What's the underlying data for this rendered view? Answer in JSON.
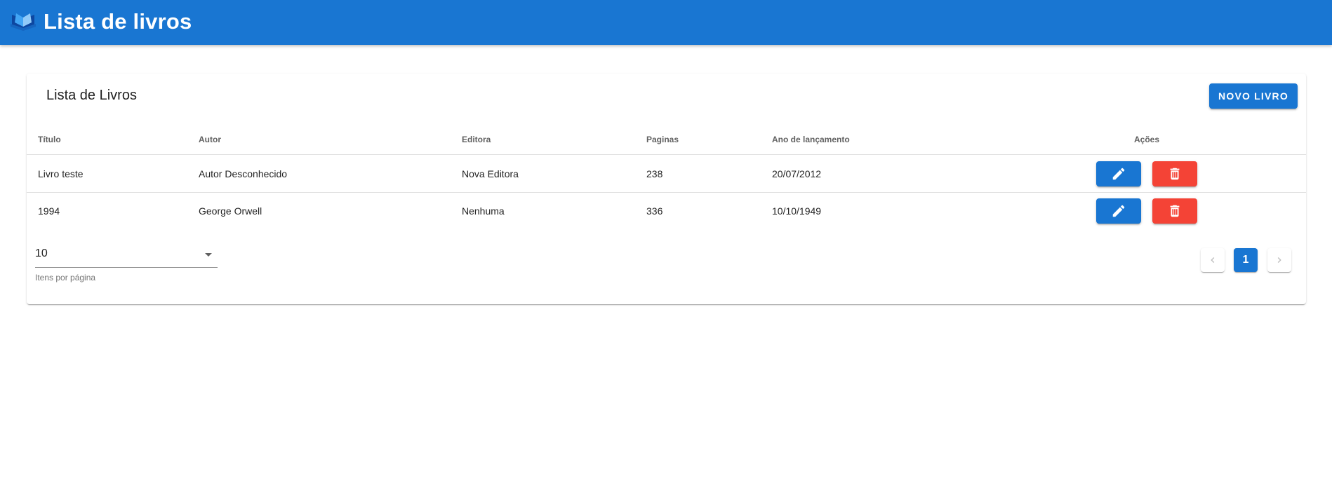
{
  "app_bar": {
    "title": "Lista de livros",
    "logo_icon": "open-book-icon",
    "color": "#1976d2"
  },
  "card": {
    "title": "Lista de Livros",
    "new_button_label": "NOVO LIVRO"
  },
  "table": {
    "headers": {
      "titulo": "Título",
      "autor": "Autor",
      "editora": "Editora",
      "paginas": "Paginas",
      "ano": "Ano de lançamento",
      "acoes": "Ações"
    },
    "rows": [
      {
        "titulo": "Livro teste",
        "autor": "Autor Desconhecido",
        "editora": "Nova Editora",
        "paginas": "238",
        "ano": "20/07/2012"
      },
      {
        "titulo": "1994",
        "autor": "George Orwell",
        "editora": "Nenhuma",
        "paginas": "336",
        "ano": "10/10/1949"
      }
    ],
    "edit_icon": "pencil-icon",
    "delete_icon": "trash-icon",
    "edit_color": "#1976d2",
    "delete_color": "#f44336"
  },
  "footer": {
    "items_per_page_value": "10",
    "items_per_page_label": "Itens por página",
    "current_page": "1"
  }
}
